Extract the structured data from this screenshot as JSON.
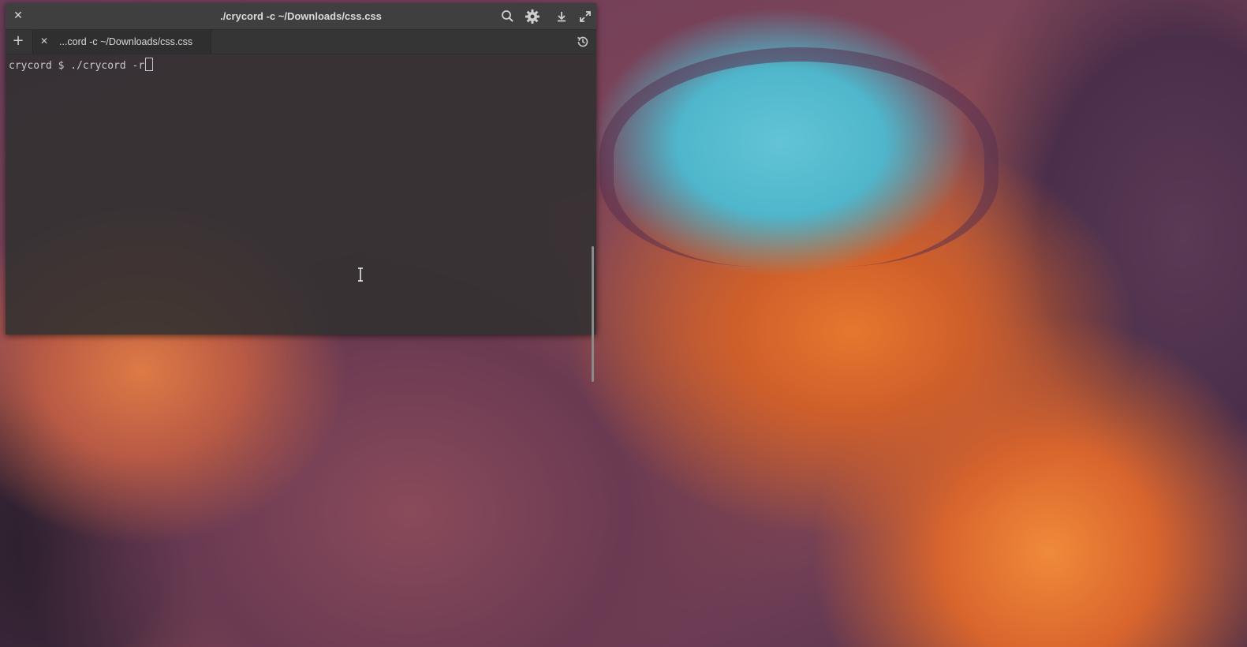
{
  "desktop": {
    "wallpaper": "antelope-canyon-wallpaper"
  },
  "terminal": {
    "title": "./crycord -c ~/Downloads/css.css",
    "tabs": [
      {
        "label": "...cord -c ~/Downloads/css.css",
        "active": true
      }
    ],
    "prompt": "crycord $ ./crycord -r",
    "icons": {
      "close": "close-icon",
      "search": "search-icon",
      "settings": "gear-icon",
      "download": "download-icon",
      "maximize": "maximize-icon",
      "new_tab": "plus-icon",
      "history": "history-icon"
    },
    "colors": {
      "titlebar": "#3f3f3f",
      "tabbar": "#353535",
      "body": "#303030",
      "text": "#c8c8c8"
    }
  }
}
